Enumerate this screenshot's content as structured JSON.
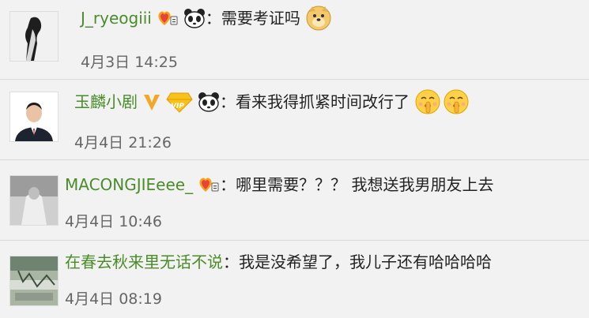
{
  "comments": [
    {
      "username": "J_ryeogiii",
      "colon": "：",
      "text": "需要考证吗",
      "time": "4月3日 14:25",
      "badges": [
        "fan-heart-badge-icon",
        "panda-icon"
      ],
      "trailing_emoji": [
        "doge-emoji-icon"
      ]
    },
    {
      "username": "玉麟小剧",
      "colon": "：",
      "text": "看来我得抓紧时间改行了",
      "time": "4月4日 21:26",
      "badges": [
        "verified-v-icon",
        "vip-diamond-icon",
        "panda-icon"
      ],
      "trailing_emoji": [
        "shush-emoji-icon",
        "shush-emoji-icon"
      ]
    },
    {
      "username": "MACONGJIEeee_",
      "colon": "：",
      "text": "哪里需要？？？ 我想送我男朋友上去",
      "time": "4月4日 10:46",
      "badges": [
        "fan-heart-badge-icon"
      ],
      "trailing_emoji": []
    },
    {
      "username": "在春去秋来里无话不说",
      "colon": "：",
      "text": "我是没希望了，我儿子还有哈哈哈哈",
      "time": "4月4日 08:19",
      "badges": [],
      "trailing_emoji": []
    }
  ],
  "colors": {
    "username": "#4a8c2a",
    "text": "#222222",
    "time": "#666666",
    "background": "#f2f2f2",
    "verified": "#f5a623",
    "vip": "#f5b800"
  }
}
